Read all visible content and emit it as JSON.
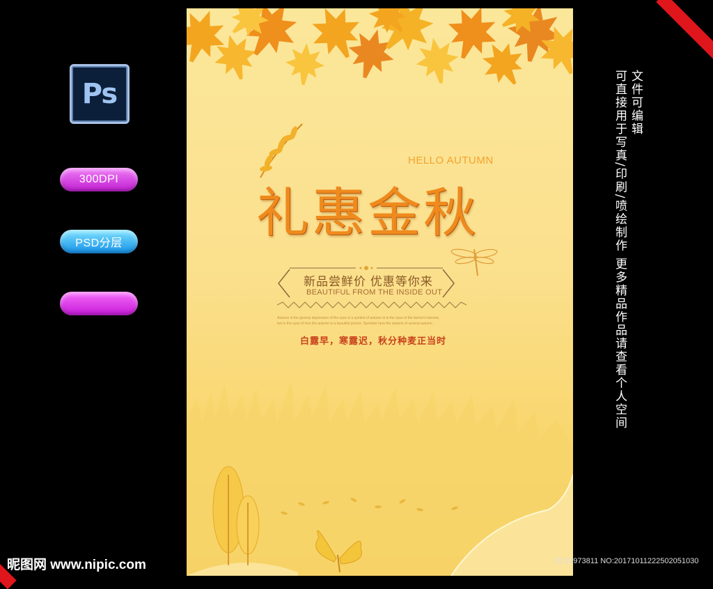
{
  "sidebar": {
    "ps_label": "Ps",
    "dpi_label": "300DPI",
    "psd_label": "PSD分层",
    "blank_label": ""
  },
  "poster": {
    "hello": "HELLO AUTUMN",
    "title": "礼惠金秋",
    "subtitle": "新品尝鲜价 优惠等你来",
    "subtitle_en": "BEAUTIFUL FROM THE INSIDE OUT",
    "small_line1": "Autumn in the gloomy depression of the eyes is a symbol of autumn is in the eyes of the farmer's harvest,",
    "small_line2": "but in the eyes of love the autumn is a beautiful picture. Spondee here the autumn of several autumn",
    "poem": "白露早，寒露迟，秋分种麦正当时"
  },
  "right_text": {
    "line1": "文件可编辑",
    "line2": "可直接用于写真/印刷/喷绘制作  更多精品作品请查看个人空间"
  },
  "footer": {
    "logo": "昵图网 www.nipic.com",
    "id": "ID:23973811 NO:20171011222502051030"
  },
  "colors": {
    "background": "#000000",
    "accent_red": "#e0161d",
    "poster_yellow": "#fbe79a",
    "title_orange": "#ef8a1d",
    "poem_red": "#c8421c"
  }
}
